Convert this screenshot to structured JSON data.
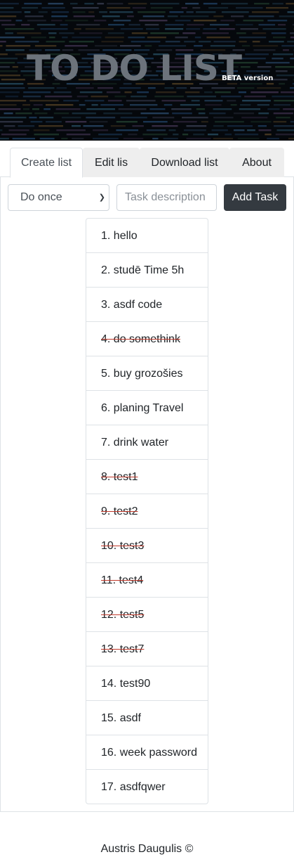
{
  "banner": {
    "title": "TO DO LIST",
    "subtitle": "BETA version"
  },
  "tabs": [
    {
      "label": "Create list",
      "active": true
    },
    {
      "label": "Edit lis",
      "active": false
    },
    {
      "label": "Download list",
      "active": false
    },
    {
      "label": "About",
      "active": false
    }
  ],
  "form": {
    "frequency_selected": "Do once",
    "frequency_icon": "chevron-down-icon",
    "task_placeholder": "Task description",
    "add_label": "Add Task"
  },
  "tasks": [
    {
      "text": "1. hello",
      "done": false
    },
    {
      "text": "2. studē Time 5h",
      "done": false
    },
    {
      "text": "3. asdf code",
      "done": false
    },
    {
      "text": "4. do somethink",
      "done": true
    },
    {
      "text": "5. buy grozošies",
      "done": false
    },
    {
      "text": "6. planing Travel",
      "done": false
    },
    {
      "text": "7. drink water",
      "done": false
    },
    {
      "text": "8. test1",
      "done": true
    },
    {
      "text": "9. test2",
      "done": true
    },
    {
      "text": "10. test3",
      "done": true
    },
    {
      "text": "11. test4",
      "done": true
    },
    {
      "text": "12. test5",
      "done": true
    },
    {
      "text": "13. test7",
      "done": true
    },
    {
      "text": "14. test90",
      "done": false
    },
    {
      "text": "15. asdf",
      "done": false
    },
    {
      "text": "16. week password",
      "done": false
    },
    {
      "text": "17. asdfqwer",
      "done": false
    }
  ],
  "footer": {
    "text": "Austris Daugulis ©"
  },
  "colors": {
    "button_dark": "#343a40",
    "strike": "#c0392b",
    "banner_title": "#6c737b"
  }
}
